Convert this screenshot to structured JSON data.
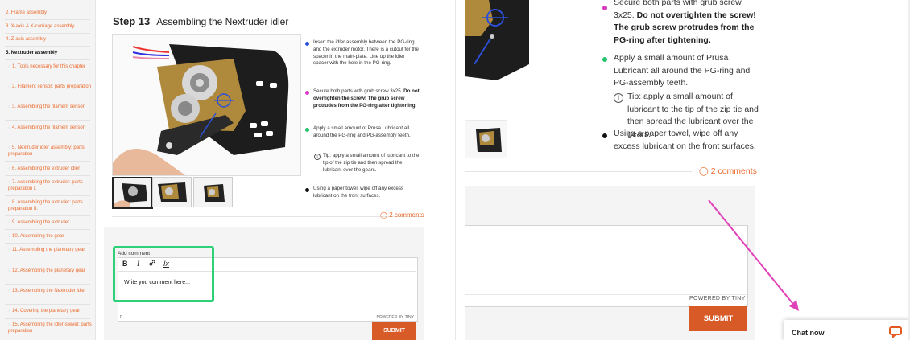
{
  "sidebar": {
    "sections": [
      {
        "label": "2. Frame assembly"
      },
      {
        "label": "3. X-axis & X-carriage assembly"
      },
      {
        "label": "4. Z-axis assembly"
      },
      {
        "label": "5. Nextruder assembly",
        "active": true
      }
    ],
    "sub_items": [
      {
        "label": "1. Tools necessary for this chapter"
      },
      {
        "label": "2. Filament sensor: parts preparation"
      },
      {
        "label": "3. Assembling the filament sensor"
      },
      {
        "label": "4. Assembling the filament sensor"
      },
      {
        "label": "5. Nextruder idler assembly: parts preparation"
      },
      {
        "label": "6. Assembling the extruder idler"
      },
      {
        "label": "7. Assembling the extruder: parts preparation I."
      },
      {
        "label": "8. Assembling the extruder: parts preparation II."
      },
      {
        "label": "9. Assembling the extruder"
      },
      {
        "label": "10. Assembling the gear"
      },
      {
        "label": "11. Assembling the planetary gear"
      },
      {
        "label": "12. Assembling the planetary gear"
      },
      {
        "label": "13. Assembling the Nextruder idler"
      },
      {
        "label": "14. Covering the planetary gear"
      },
      {
        "label": "15. Assembling the idler-swivel: parts preparation"
      }
    ]
  },
  "step": {
    "number": "Step 13",
    "title": "Assembling the Nextruder idler"
  },
  "instructions": {
    "b1": "Insert the idler assembly between the PG-ring and the extruder motor. There is a cutout for the spacer in the main-plate. Line up the idler spacer with the hole in the PG-ring.",
    "b2_plain": "Secure both parts with grub screw 3x25.",
    "b2_bold": "Do not overtighten the screw! The grub screw protrudes from the PG-ring after tightening.",
    "b3": "Apply a small amount of Prusa Lubricant all around the PG-ring and PG-assembly teeth.",
    "tip": "Tip: apply a small amount of lubricant to the tip of the zip tie and then spread the lubricant over the gears.",
    "b4": "Using a paper towel, wipe off any excess lubricant on the front surfaces."
  },
  "comments_link": "2 comments",
  "comment_form": {
    "label": "Add comment",
    "placeholder_text": "Write you comment here...",
    "toolbar": {
      "bold": "B",
      "italic": "I",
      "clear_format": "Ix"
    },
    "status_path": "P",
    "powered_by": "POWERED BY TINY",
    "submit": "SUBMIT"
  },
  "right_instructions": {
    "b2_plain_cut": "Secure both parts with grub screw 3x25.",
    "b2_bold": "Do not overtighten the screw! The grub screw protrudes from the PG-ring after tightening."
  },
  "chat": {
    "label": "Chat now"
  },
  "colors": {
    "accent": "#ea6a2c",
    "submit_bg": "#d85a27",
    "highlight": "#2fd07a",
    "arrow": "#e040b8",
    "bullet_blue": "#2b4fd8",
    "bullet_magenta": "#d73bc2",
    "bullet_green": "#23c36b",
    "bullet_black": "#111111"
  }
}
